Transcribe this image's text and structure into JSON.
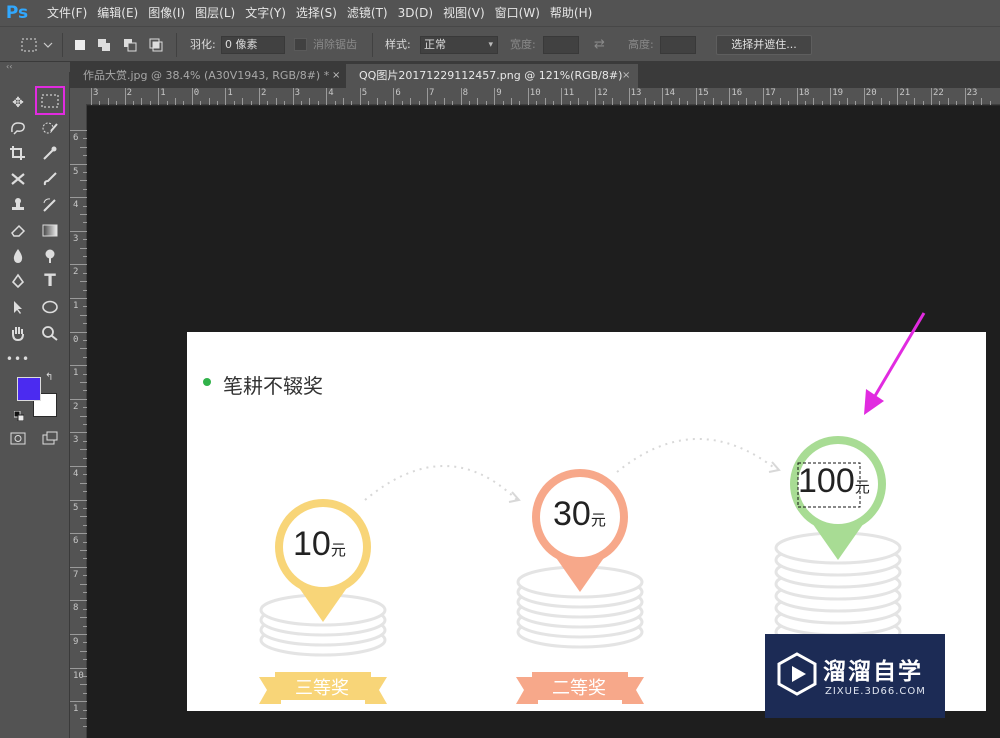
{
  "app": {
    "logo": "Ps"
  },
  "menu": [
    "文件(F)",
    "编辑(E)",
    "图像(I)",
    "图层(L)",
    "文字(Y)",
    "选择(S)",
    "滤镜(T)",
    "3D(D)",
    "视图(V)",
    "窗口(W)",
    "帮助(H)"
  ],
  "options": {
    "feather_label": "羽化:",
    "feather_value": "0 像素",
    "antialias_label": "消除锯齿",
    "style_label": "样式:",
    "style_value": "正常",
    "width_label": "宽度:",
    "height_label": "高度:",
    "select_mask_button": "选择并遮住..."
  },
  "tabs": [
    {
      "title": "作品大赏.jpg @ 38.4% (A30V1943, RGB/8#) *",
      "close": "×",
      "active": false
    },
    {
      "title": "QQ图片20171229112457.png @ 121%(RGB/8#)",
      "close": "×",
      "active": true
    }
  ],
  "ruler": {
    "h_labels": [
      "3",
      "2",
      "1",
      "0",
      "1",
      "2",
      "3",
      "4",
      "5",
      "6",
      "7",
      "8",
      "9",
      "10",
      "11",
      "12",
      "13",
      "14",
      "15",
      "16",
      "17",
      "18",
      "19",
      "20",
      "21",
      "22",
      "23"
    ],
    "v_labels": [
      "6",
      "5",
      "4",
      "3",
      "2",
      "1",
      "0",
      "1",
      "2",
      "3",
      "4",
      "5",
      "6",
      "7",
      "8",
      "9",
      "10",
      "1"
    ]
  },
  "colors": {
    "foreground": "#4b2bf0",
    "background": "#ffffff",
    "highlight": "#e12be0",
    "prize3": "#f8d578",
    "prize2": "#f7a88a",
    "prize1": "#a8dc94"
  },
  "canvas": {
    "title": "笔耕不辍奖",
    "prizes": [
      {
        "amount": "10",
        "unit": "元",
        "ribbon": "三等奖"
      },
      {
        "amount": "30",
        "unit": "元",
        "ribbon": "二等奖"
      },
      {
        "amount": "100",
        "unit": "元"
      }
    ]
  },
  "watermark": {
    "title": "溜溜自学",
    "subtitle": "ZIXUE.3D66.COM"
  }
}
